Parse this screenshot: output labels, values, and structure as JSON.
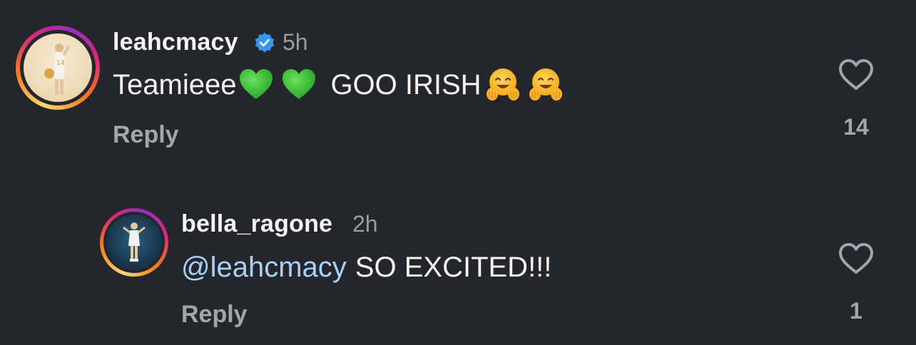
{
  "comments": [
    {
      "username": "leahcmacy",
      "verified": true,
      "time": "5h",
      "text": "Teamieee",
      "text_after_emojis": "GOO IRISH",
      "emojis_1": [
        "green-heart",
        "green-heart"
      ],
      "emojis_2": [
        "hugging-face",
        "hugging-face"
      ],
      "reply_label": "Reply",
      "likes": "14"
    },
    {
      "username": "bella_ragone",
      "verified": false,
      "time": "2h",
      "mention": "@leahcmacy",
      "text": "SO EXCITED!!!",
      "reply_label": "Reply",
      "likes": "1"
    }
  ],
  "colors": {
    "background": "#24262b",
    "mention": "#a8d1f5",
    "verified_badge": "#3797f0",
    "muted_text": "#a3a5ab"
  }
}
